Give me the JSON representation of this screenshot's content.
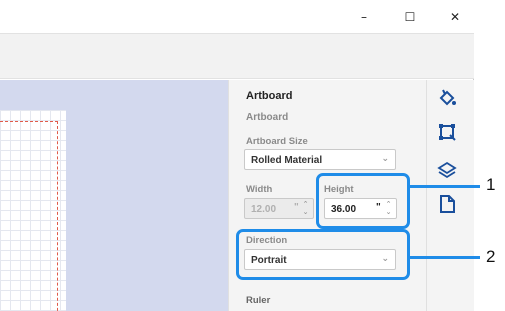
{
  "window": {
    "minimize_icon": "minimize-icon",
    "maximize_icon": "maximize-icon",
    "close_icon": "close-icon",
    "minimize_glyph": "–",
    "maximize_glyph": "☐",
    "close_glyph": "✕"
  },
  "panel": {
    "title": "Artboard",
    "section_title": "Artboard",
    "artboard_size_label": "Artboard Size",
    "artboard_size_value": "Rolled Material",
    "width_label": "Width",
    "width_value": "12.00",
    "width_unit": "\"",
    "height_label": "Height",
    "height_value": "36.00",
    "height_unit": "\"",
    "direction_label": "Direction",
    "direction_value": "Portrait",
    "ruler_label": "Ruler"
  },
  "rail": {
    "icons": [
      "paint-bucket-icon",
      "transform-icon",
      "layers-icon",
      "document-icon"
    ]
  },
  "callouts": {
    "one": "1",
    "two": "2"
  },
  "colors": {
    "accent": "#1f8ce8",
    "canvas_bg": "#d3d9ee",
    "artboard_border": "#e05a4a",
    "icon_blue": "#1a4f9c"
  }
}
